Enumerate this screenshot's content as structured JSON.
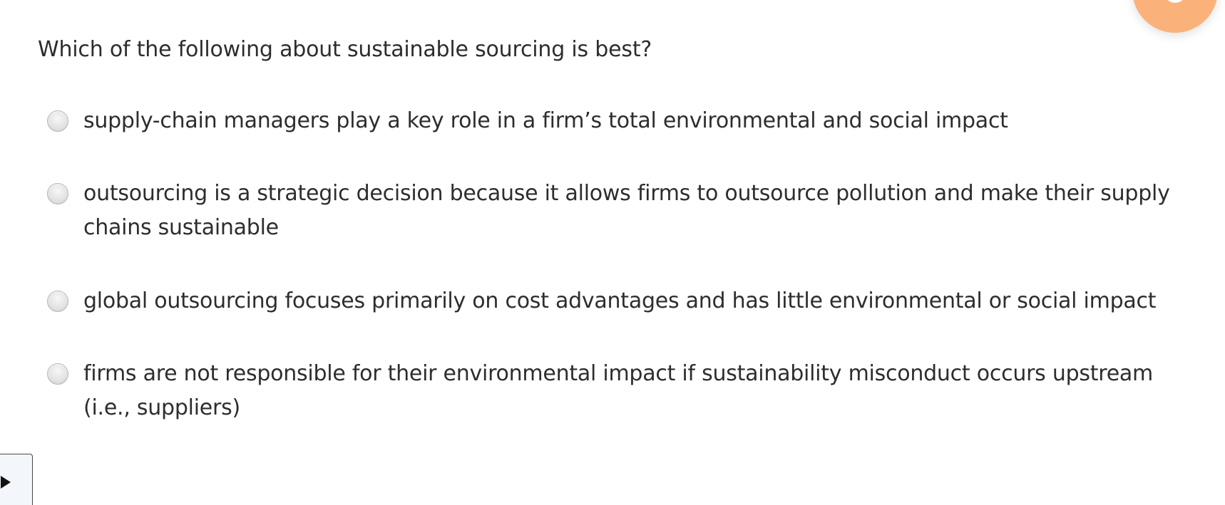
{
  "question": {
    "text": "Which of the following about sustainable sourcing is best?"
  },
  "options": [
    {
      "label": "supply-chain managers play a key role in a firm’s total environmental and social impact",
      "selected": false
    },
    {
      "label": "outsourcing is a strategic decision because it allows firms to outsource pollution and make their supply chains sustainable",
      "selected": false
    },
    {
      "label": "global outsourcing focuses primarily on cost advantages and has little environmental or social impact",
      "selected": false
    },
    {
      "label": "firms are not responsible for their environmental impact if sustainability misconduct occurs upstream (i.e., suppliers)",
      "selected": false
    }
  ],
  "colors": {
    "text": "#2d2d2d",
    "fab": "#fbb27a",
    "radio_fill": "#e4e4e4",
    "radio_border": "#b5b5b5"
  },
  "icons": {
    "fab": "help-icon",
    "play": "play-icon"
  }
}
